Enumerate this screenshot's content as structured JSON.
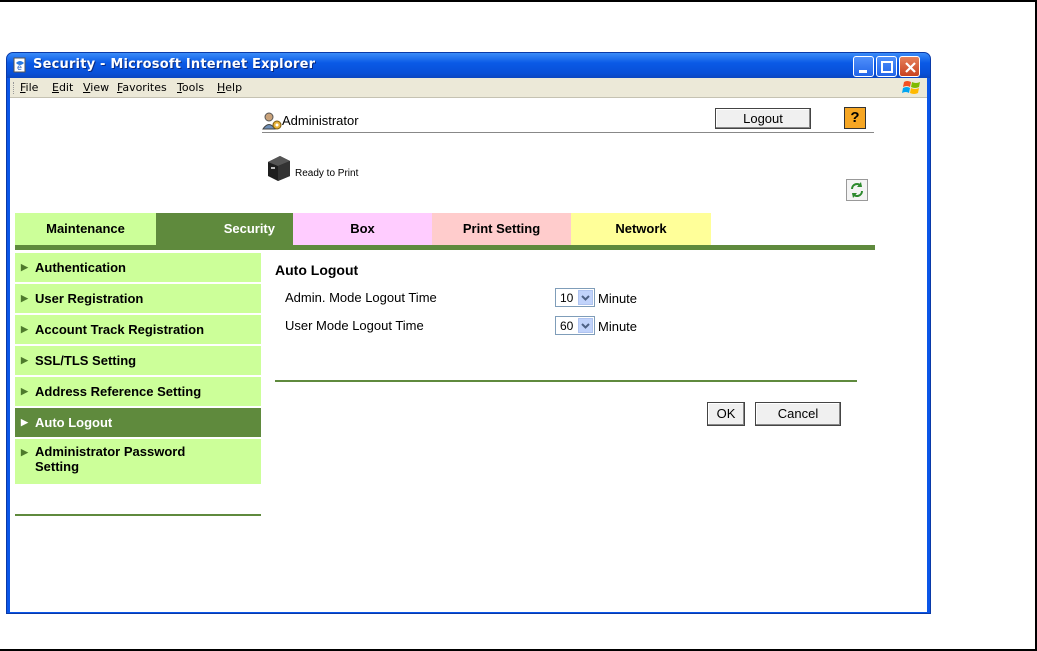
{
  "window": {
    "title": "Security - Microsoft Internet Explorer"
  },
  "menubar": {
    "items": [
      "File",
      "Edit",
      "View",
      "Favorites",
      "Tools",
      "Help"
    ]
  },
  "header": {
    "user_label": "Administrator",
    "logout_label": "Logout",
    "help_label": "?",
    "status_text": "Ready to Print"
  },
  "tabs": [
    {
      "label": "Maintenance",
      "color": "#ccff99"
    },
    {
      "label": "Security",
      "color": "#5f8a3d",
      "active": true
    },
    {
      "label": "Box",
      "color": "#ffccff"
    },
    {
      "label": "Print Setting",
      "color": "#ffcccc"
    },
    {
      "label": "Network",
      "color": "#ffff99"
    }
  ],
  "sidebar": {
    "items": [
      {
        "label": "Authentication"
      },
      {
        "label": "User Registration"
      },
      {
        "label": "Account Track Registration"
      },
      {
        "label": "SSL/TLS Setting"
      },
      {
        "label": "Address Reference Setting"
      },
      {
        "label": "Auto Logout",
        "active": true
      },
      {
        "label": "Administrator Password Setting"
      }
    ]
  },
  "main": {
    "section_title": "Auto Logout",
    "rows": [
      {
        "label": "Admin. Mode Logout Time",
        "value": "10",
        "unit": "Minute"
      },
      {
        "label": "User Mode Logout Time",
        "value": "60",
        "unit": "Minute"
      }
    ],
    "ok_label": "OK",
    "cancel_label": "Cancel"
  }
}
